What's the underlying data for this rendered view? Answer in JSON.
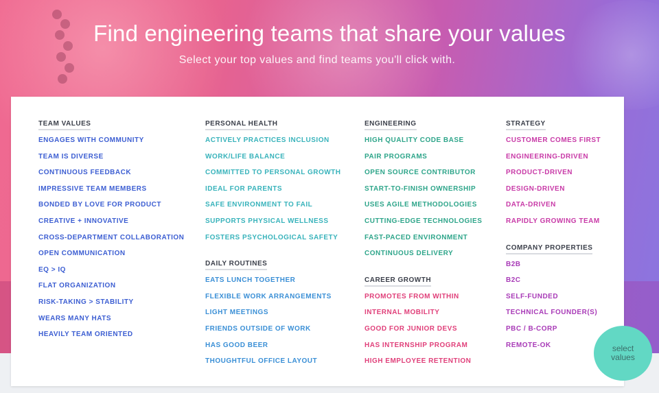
{
  "hero": {
    "title": "Find engineering teams that share your values",
    "subtitle": "Select your top values and find teams you'll click with."
  },
  "columns": {
    "team": {
      "heading": "TEAM VALUES",
      "items": [
        "ENGAGES WITH COMMUNITY",
        "TEAM IS DIVERSE",
        "CONTINUOUS FEEDBACK",
        "IMPRESSIVE TEAM MEMBERS",
        "BONDED BY LOVE FOR PRODUCT",
        "CREATIVE + INNOVATIVE",
        "CROSS-DEPARTMENT COLLABORATION",
        "OPEN COMMUNICATION",
        "EQ > IQ",
        "FLAT ORGANIZATION",
        "RISK-TAKING > STABILITY",
        "WEARS MANY HATS",
        "HEAVILY TEAM ORIENTED"
      ]
    },
    "health": {
      "heading": "PERSONAL HEALTH",
      "items": [
        "ACTIVELY PRACTICES INCLUSION",
        "WORK/LIFE BALANCE",
        "COMMITTED TO PERSONAL GROWTH",
        "IDEAL FOR PARENTS",
        "SAFE ENVIRONMENT TO FAIL",
        "SUPPORTS PHYSICAL WELLNESS",
        "FOSTERS PSYCHOLOGICAL SAFETY"
      ]
    },
    "daily": {
      "heading": "DAILY ROUTINES",
      "items": [
        "EATS LUNCH TOGETHER",
        "FLEXIBLE WORK ARRANGEMENTS",
        "LIGHT MEETINGS",
        "FRIENDS OUTSIDE OF WORK",
        "HAS GOOD BEER",
        "THOUGHTFUL OFFICE LAYOUT"
      ]
    },
    "engineering": {
      "heading": "ENGINEERING",
      "items": [
        "HIGH QUALITY CODE BASE",
        "PAIR PROGRAMS",
        "OPEN SOURCE CONTRIBUTOR",
        "START-TO-FINISH OWNERSHIP",
        "USES AGILE METHODOLOGIES",
        "CUTTING-EDGE TECHNOLOGIES",
        "FAST-PACED ENVIRONMENT",
        "CONTINUOUS DELIVERY"
      ]
    },
    "career": {
      "heading": "CAREER GROWTH",
      "items": [
        "PROMOTES FROM WITHIN",
        "INTERNAL MOBILITY",
        "GOOD FOR JUNIOR DEVS",
        "HAS INTERNSHIP PROGRAM",
        "HIGH EMPLOYEE RETENTION"
      ]
    },
    "strategy": {
      "heading": "STRATEGY",
      "items": [
        "CUSTOMER COMES FIRST",
        "ENGINEERING-DRIVEN",
        "PRODUCT-DRIVEN",
        "DESIGN-DRIVEN",
        "DATA-DRIVEN",
        "RAPIDLY GROWING TEAM"
      ]
    },
    "company": {
      "heading": "COMPANY PROPERTIES",
      "items": [
        "B2B",
        "B2C",
        "SELF-FUNDED",
        "TECHNICAL FOUNDER(S)",
        "PBC / B-CORP",
        "REMOTE-OK"
      ]
    }
  },
  "select_button": {
    "label": "select values"
  },
  "colors": {
    "team": "#3c5ed2",
    "health": "#38b3bb",
    "daily": "#3a8fd6",
    "engineering": "#2ea58a",
    "career": "#e0407a",
    "strategy": "#c83aa7",
    "company": "#a83ab7",
    "button": "#62d8c4"
  }
}
